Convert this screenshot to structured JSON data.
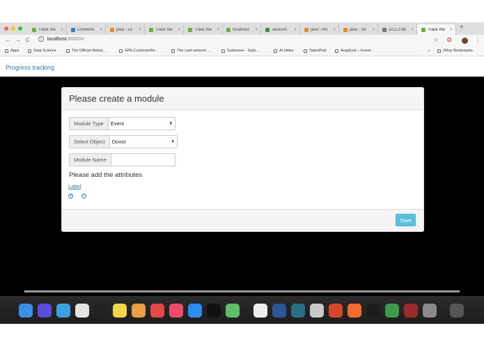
{
  "browser": {
    "tabs": [
      {
        "label": "Track me",
        "color": "#7aa83e"
      },
      {
        "label": "Converte",
        "color": "#3d7bc6"
      },
      {
        "label": "java - Lo",
        "color": "#e8862c"
      },
      {
        "label": "Track me",
        "color": "#7aa83e"
      },
      {
        "label": "Track me",
        "color": "#7aa83e"
      },
      {
        "label": "localhost",
        "color": "#7aa83e"
      },
      {
        "label": "Jackson",
        "color": "#3a8f5c"
      },
      {
        "label": "java - Ho",
        "color": "#e8862c"
      },
      {
        "label": "java - Se",
        "color": "#e8862c"
      },
      {
        "label": "10.2.2.88",
        "color": "#777777"
      },
      {
        "label": "Track me",
        "color": "#7aa83e"
      }
    ],
    "close_glyph": "×",
    "new_tab_glyph": "+",
    "url_host": "localhost",
    "url_path": ":8080/#/",
    "bookmarks": [
      {
        "label": "Apps"
      },
      {
        "label": "Data Science"
      },
      {
        "label": "The Official Websi..."
      },
      {
        "label": "SPE-CustomerRe..."
      },
      {
        "label": "The cnet network ..."
      },
      {
        "label": "Subscene - Suits ..."
      },
      {
        "label": "AI slides"
      },
      {
        "label": "TalentPad"
      },
      {
        "label": "AngelList – Invest ..."
      }
    ],
    "other_bookmarks": "Other Bookmarks",
    "overflow": "»"
  },
  "app": {
    "brand": "Progress tracking",
    "panel_title": "Please create a module",
    "module_type_label": "Module Type",
    "module_type_value": "Event",
    "select_object_label": "Select Object",
    "select_object_value": "Donor",
    "module_name_label": "Module Name",
    "module_name_value": "",
    "attributes_heading": "Please add the attributes",
    "attribute_label_link": "Label",
    "add_glyph": "+",
    "remove_glyph": "−",
    "save_label": "Save"
  },
  "colors": {
    "link": "#337ab7",
    "save": "#5bc0de"
  },
  "dock": {
    "icons": [
      "finder-icon",
      "siri-icon",
      "safari-icon",
      "chrome-icon",
      "terminal-icon",
      "notes-icon",
      "photos-icon",
      "news-icon",
      "music-icon",
      "app-store-icon",
      "intellij-icon",
      "atom-icon",
      "slack-icon",
      "word-icon",
      "network-icon",
      "preview-icon",
      "powerpoint-icon",
      "postman-icon",
      "terminal2-icon",
      "sourcetree-icon",
      "dictionary-icon",
      "system-preferences-icon",
      "trash-icon"
    ],
    "colors": [
      "#3d8ee6",
      "#5a4cd6",
      "#3aa0e0",
      "#e4e4e4",
      "#222222",
      "#f2d64a",
      "#e8a040",
      "#e6484a",
      "#f04a6a",
      "#2d8cf0",
      "#111111",
      "#5dbf6a",
      "#eeeeee",
      "#2b579a",
      "#2a6f8a",
      "#c9c9c9",
      "#d24726",
      "#f26c30",
      "#1c1c1c",
      "#3d9c4a",
      "#9a2b2b",
      "#8a8a8a",
      "#555555"
    ]
  }
}
